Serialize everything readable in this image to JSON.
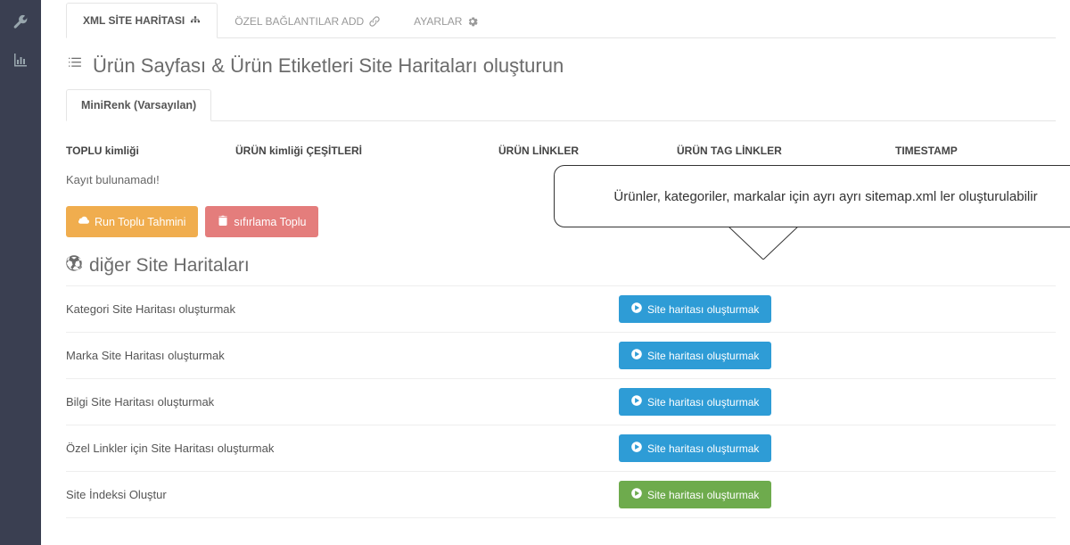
{
  "topTabs": {
    "xml": "XML SİTE HARİTASI",
    "custom": "ÖZEL BAĞLANTILAR ADD",
    "settings": "AYARLAR"
  },
  "heading1": "Ürün Sayfası & Ürün Etiketleri Site Haritaları oluşturun",
  "subTab": "MiniRenk (Varsayılan)",
  "table": {
    "col1": "TOPLU kimliği",
    "col2": "ÜRÜN kimliği ÇEŞİTLERİ",
    "col3": "ÜRÜN LİNKLER",
    "col4": "ÜRÜN TAG LİNKLER",
    "col5": "TIMESTAMP",
    "empty": "Kayıt bulunamadı!"
  },
  "buttons": {
    "run": "Run Toplu Tahmini",
    "reset": "sıfırlama Toplu",
    "create": "Site haritası oluşturmak"
  },
  "heading2": "diğer Site Haritaları",
  "rows": {
    "category": "Kategori Site Haritası oluşturmak",
    "brand": "Marka Site Haritası oluşturmak",
    "info": "Bilgi Site Haritası oluşturmak",
    "customlinks": "Özel Linkler için Site Haritası oluşturmak",
    "siteindex": "Site İndeksi Oluştur"
  },
  "callout": "Ürünler, kategoriler, markalar için ayrı ayrı sitemap.xml ler oluşturulabilir"
}
